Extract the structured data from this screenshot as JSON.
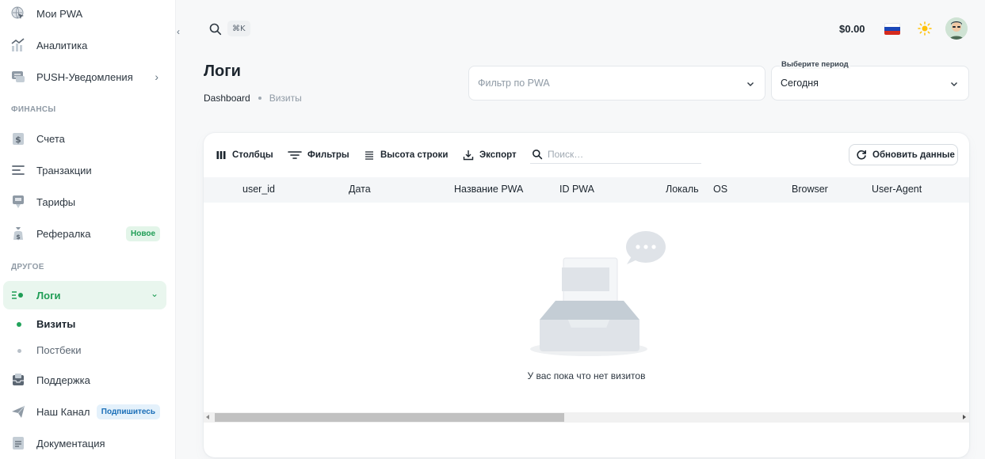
{
  "sidebar": {
    "items_top": [
      {
        "label": "Мои PWA",
        "icon": "globe-pointer-icon"
      },
      {
        "label": "Аналитика",
        "icon": "chart-icon"
      },
      {
        "label": "PUSH-Уведомления",
        "icon": "chat-icon",
        "chevron": "›"
      }
    ],
    "section_finance": "ФИНАНСЫ",
    "items_finance": [
      {
        "label": "Счета",
        "icon": "dollar-doc-icon"
      },
      {
        "label": "Транзакции",
        "icon": "lines-icon"
      },
      {
        "label": "Тарифы",
        "icon": "tariff-icon"
      },
      {
        "label": "Рефералка",
        "icon": "money-bag-icon",
        "badge": "Новое"
      }
    ],
    "section_other": "ДРУГОЕ",
    "logs": {
      "label": "Логи",
      "icon": "logs-icon",
      "chevron": "⌄"
    },
    "logs_children": [
      {
        "label": "Визиты",
        "active": true
      },
      {
        "label": "Постбеки",
        "active": false
      }
    ],
    "items_bottom": [
      {
        "label": "Поддержка",
        "icon": "inbox-icon"
      },
      {
        "label": "Наш Канал",
        "icon": "paper-plane-icon",
        "badge": "Подпишитесь"
      },
      {
        "label": "Документация",
        "icon": "document-icon"
      }
    ],
    "collapse": "‹"
  },
  "topbar": {
    "shortcut": "⌘K",
    "balance": "$0.00",
    "language": "ru"
  },
  "header": {
    "title": "Логи",
    "breadcrumb": [
      "Dashboard",
      "Визиты"
    ]
  },
  "filters": {
    "pwa_placeholder": "Фильтр по PWA",
    "period_label": "Выберите период",
    "period_value": "Сегодня"
  },
  "toolbar": {
    "columns": "Столбцы",
    "filters": "Фильтры",
    "density": "Высота строки",
    "export": "Экспорт",
    "search_placeholder": "Поиск…",
    "refresh": "Обновить данные"
  },
  "table": {
    "columns": [
      "user_id",
      "Дата",
      "Название PWA",
      "ID PWA",
      "Локаль",
      "OS",
      "Browser",
      "User-Agent"
    ],
    "rows": [],
    "empty_text": "У вас пока что нет визитов"
  },
  "colors": {
    "accent": "#1f9d55",
    "active_bg": "#e9f6ee"
  }
}
